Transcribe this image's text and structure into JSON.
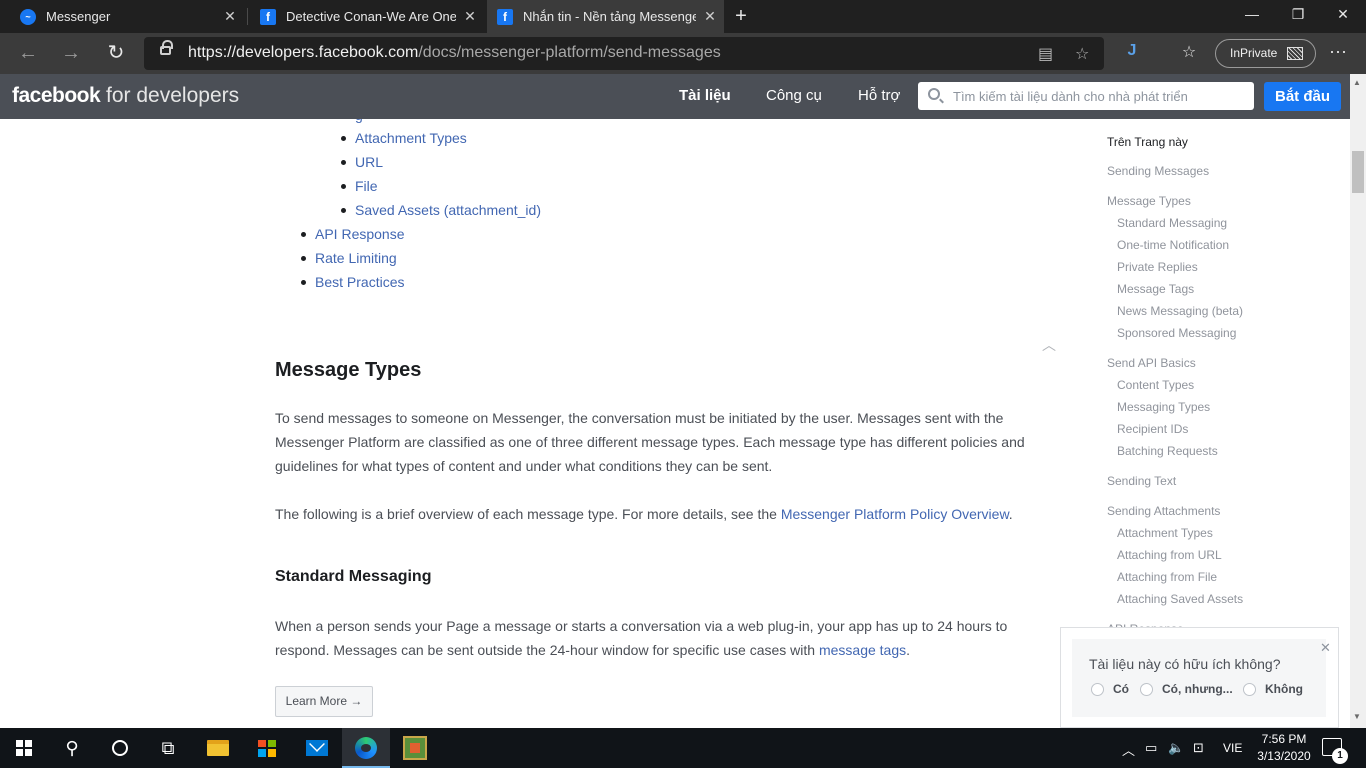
{
  "browser": {
    "tabs": [
      {
        "title": "Messenger",
        "icon": "messenger-icon"
      },
      {
        "title": "Detective Conan-We Are One - T",
        "icon": "facebook-icon"
      },
      {
        "title": "Nhắn tin - Nền tảng Messenger",
        "icon": "facebook-icon"
      }
    ],
    "url_host": "https://developers.facebook.com",
    "url_path": "/docs/messenger-platform/send-messages",
    "inprivate_label": "InPrivate"
  },
  "header": {
    "logo_bold": "facebook",
    "logo_rest": " for developers",
    "nav": [
      "Tài liệu",
      "Công cụ",
      "Hỗ trợ"
    ],
    "search_placeholder": "Tìm kiếm tài liệu dành cho nhà phát triển",
    "start_button": "Bắt đầu"
  },
  "toc_partial": "g",
  "toc_sub_items": [
    "Attachment Types",
    "URL",
    "File",
    "Saved Assets (attachment_id)"
  ],
  "toc_items": [
    "API Response",
    "Rate Limiting",
    "Best Practices"
  ],
  "main": {
    "section_title": "Message Types",
    "para1": "To send messages to someone on Messenger, the conversation must be initiated by the user. Messages sent with the Messenger Platform are classified as one of three different message types. Each message type has different policies and guidelines for what types of content and under what conditions they can be sent.",
    "para2_text": "The following is a brief overview of each message type. For more details, see the ",
    "para2_link": "Messenger Platform Policy Overview",
    "para2_end": ".",
    "sub_title": "Standard Messaging",
    "para3_text": "When a person sends your Page a message or starts a conversation via a web plug-in, your app has up to 24 hours to respond. Messages can be sent outside the 24-hour window for specific use cases with ",
    "para3_link": "message tags",
    "para3_end": ".",
    "learn_more": "Learn More →"
  },
  "right_toc": {
    "title": "Trên Trang này",
    "items": [
      {
        "label": "Sending Messages",
        "level": "top"
      },
      {
        "label": "Message Types",
        "level": "top"
      },
      {
        "label": "Standard Messaging",
        "level": "sub"
      },
      {
        "label": "One-time Notification",
        "level": "sub"
      },
      {
        "label": "Private Replies",
        "level": "sub"
      },
      {
        "label": "Message Tags",
        "level": "sub"
      },
      {
        "label": "News Messaging (beta)",
        "level": "sub"
      },
      {
        "label": "Sponsored Messaging",
        "level": "sub"
      },
      {
        "label": "Send API Basics",
        "level": "top"
      },
      {
        "label": "Content Types",
        "level": "sub"
      },
      {
        "label": "Messaging Types",
        "level": "sub"
      },
      {
        "label": "Recipient IDs",
        "level": "sub"
      },
      {
        "label": "Batching Requests",
        "level": "sub"
      },
      {
        "label": "Sending Text",
        "level": "top"
      },
      {
        "label": "Sending Attachments",
        "level": "top"
      },
      {
        "label": "Attachment Types",
        "level": "sub"
      },
      {
        "label": "Attaching from URL",
        "level": "sub"
      },
      {
        "label": "Attaching from File",
        "level": "sub"
      },
      {
        "label": "Attaching Saved Assets",
        "level": "sub"
      },
      {
        "label": "API Response",
        "level": "top"
      }
    ]
  },
  "feedback": {
    "question": "Tài liệu này có hữu ích không?",
    "options": [
      "Có",
      "Có, nhưng...",
      "Không"
    ]
  },
  "taskbar": {
    "lang": "VIE",
    "time": "7:56 PM",
    "date": "3/13/2020",
    "notification_count": "1"
  },
  "colors": {
    "fb_header": "#4b4f56",
    "link": "#4267b2",
    "primary_button": "#1877f2"
  }
}
